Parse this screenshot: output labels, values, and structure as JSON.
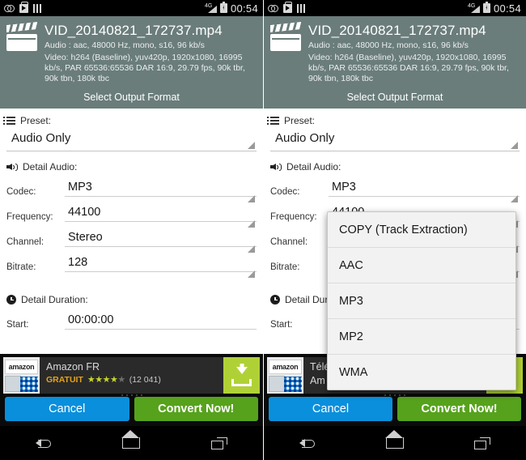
{
  "status_bar": {
    "time": "00:54",
    "network_label": "4G",
    "icons": [
      "voicemail-icon",
      "app-install-icon",
      "bars-icon",
      "signal-icon",
      "battery-icon"
    ]
  },
  "file_header": {
    "icon": "clapperboard-icon",
    "title": "VID_20140821_172737.mp4",
    "audio_line": "Audio : aac, 48000 Hz, mono, s16, 96 kb/s",
    "video_line": "Video: h264 (Baseline), yuv420p, 1920x1080, 16995 kb/s, PAR 65536:65536 DAR 16:9, 29.79 fps, 90k tbr, 90k tbn, 180k tbc",
    "select_output_format": "Select Output Format",
    "bg_color": "#6a7d7b"
  },
  "preset": {
    "icon": "list-icon",
    "label": "Preset:",
    "value": "Audio Only"
  },
  "detail_audio": {
    "icon": "speaker-icon",
    "label": "Detail Audio:",
    "fields": [
      {
        "label": "Codec:",
        "value": "MP3"
      },
      {
        "label": "Frequency:",
        "value": "44100"
      },
      {
        "label": "Channel:",
        "value": "Stereo"
      },
      {
        "label": "Bitrate:",
        "value": "128"
      }
    ]
  },
  "detail_duration": {
    "icon": "clock-icon",
    "label": "Detail Duration:",
    "start_label": "Start:",
    "start_value": "00:00:00"
  },
  "ad_left": {
    "icon_text": "amazon",
    "title": "Amazon FR",
    "free_label": "GRATUIT",
    "stars_filled": "★★★★",
    "stars_empty": "★",
    "rating_count": "(12 041)",
    "cta_icon": "download-icon",
    "cta_color": "#b0d136"
  },
  "ad_right": {
    "icon_text": "amazon",
    "title": "Télé",
    "free_label": "Am",
    "stars_filled": "",
    "stars_empty": "",
    "rating_count": "",
    "cta_icon": "download-icon",
    "cta_color": "#b0d136"
  },
  "actions": {
    "cancel_label": "Cancel",
    "cancel_color": "#0a8fdc",
    "convert_label": "Convert Now!",
    "convert_color": "#56a21c"
  },
  "nav_bar": {
    "back": "back-icon",
    "home": "home-icon",
    "recents": "recents-icon"
  },
  "codec_dropdown": {
    "visible_on": "right-panel",
    "options": [
      "COPY (Track Extraction)",
      "AAC",
      "MP3",
      "MP2",
      "WMA"
    ]
  }
}
